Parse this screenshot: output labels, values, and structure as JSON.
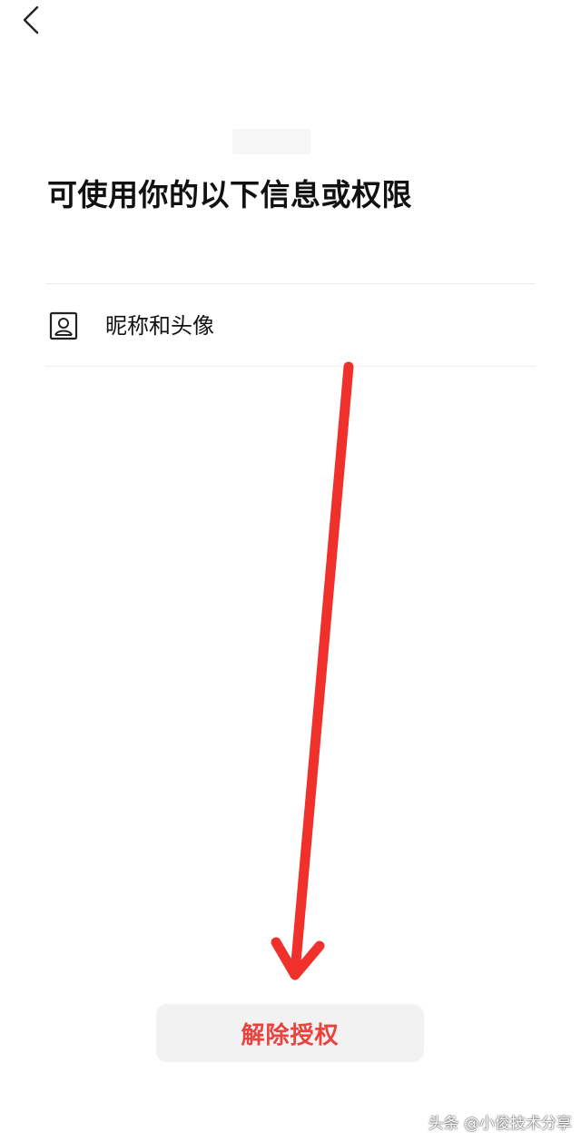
{
  "header": {
    "back_icon": "chevron-left-icon"
  },
  "page": {
    "title": "可使用你的以下信息或权限"
  },
  "permissions": [
    {
      "icon": "person-portrait-icon",
      "label": "昵称和头像"
    }
  ],
  "actions": {
    "revoke_label": "解除授权",
    "revoke_color": "#e8433e"
  },
  "annotation": {
    "arrow_color": "#f0302b"
  },
  "watermark": {
    "text": "头条 @小俊技术分享"
  }
}
